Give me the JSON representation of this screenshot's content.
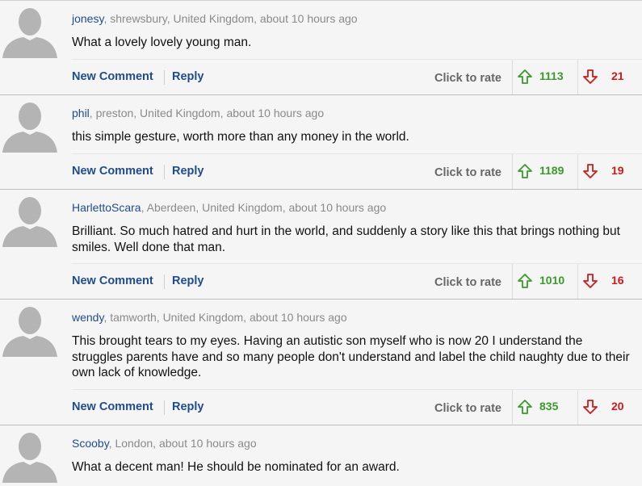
{
  "labels": {
    "new_comment": "New Comment",
    "reply": "Reply",
    "click_to_rate": "Click to rate"
  },
  "icons": {
    "avatar": "default-avatar-silhouette-icon",
    "vote_up": "arrow-up-icon",
    "vote_down": "arrow-down-icon"
  },
  "colors": {
    "link": "#1e4c8f",
    "up": "#3a9a2a",
    "down": "#cc1b1b"
  },
  "comments": [
    {
      "user": "jonesy",
      "location": ", shrewsbury, United Kingdom, about 10 hours ago",
      "text": "What a lovely lovely young man.",
      "up": "1113",
      "down": "21"
    },
    {
      "user": "phil",
      "location": ", preston, United Kingdom, about 10 hours ago",
      "text": "this simple gesture, worth more than any money in the world.",
      "up": "1189",
      "down": "19"
    },
    {
      "user": "HarlettoScara",
      "location": ", Aberdeen, United Kingdom, about 10 hours ago",
      "text": "Brilliant. So much hatred and hurt in the world, and suddenly a story like this that brings nothing but smiles. Well done that man.",
      "up": "1010",
      "down": "16"
    },
    {
      "user": "wendy",
      "location": ", tamworth, United Kingdom, about 10 hours ago",
      "text": "This brought tears to my eyes. Having an autistic son myself who is now 20 I understand the struggles parents have and so many people don't understand and label the child naughty due to their own lack of knowledge.",
      "up": "835",
      "down": "20"
    },
    {
      "user": "Scooby",
      "location": ", London, about 10 hours ago",
      "text": "What a decent man! He should be nominated for an award."
    }
  ]
}
